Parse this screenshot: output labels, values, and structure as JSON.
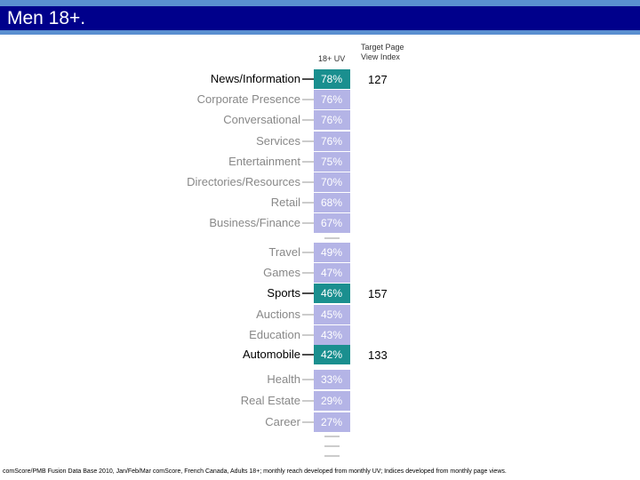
{
  "slide": {
    "title": "Men 18+.",
    "uv_header": "18+ UV",
    "index_header_line1": "Target Page",
    "index_header_line2": "View Index",
    "footnote": "comScore/PMB Fusion Data Base 2010, Jan/Feb/Mar comScore, French Canada, Adults 18+; monthly reach developed from monthly UV; Indices developed from monthly page views."
  },
  "colors": {
    "banner": "#00008b",
    "banner_rule": "#5a8fd0",
    "bar": "#b4b4e6",
    "bar_highlight": "#1a8f8f",
    "highlight_text": "#000000",
    "muted_text": "#888888"
  },
  "chart_data": {
    "type": "table",
    "columns": [
      "18+ UV",
      "Target Page View Index"
    ],
    "rows": [
      {
        "category": "News/Information",
        "uv": "78%",
        "index": "127",
        "highlight": true
      },
      {
        "category": "Corporate Presence",
        "uv": "76%",
        "index": "",
        "highlight": false
      },
      {
        "category": "Conversational",
        "uv": "76%",
        "index": "",
        "highlight": false
      },
      {
        "category": "Services",
        "uv": "76%",
        "index": "",
        "highlight": false
      },
      {
        "category": "Entertainment",
        "uv": "75%",
        "index": "",
        "highlight": false
      },
      {
        "category": "Directories/Resources",
        "uv": "70%",
        "index": "",
        "highlight": false
      },
      {
        "category": "Retail",
        "uv": "68%",
        "index": "",
        "highlight": false
      },
      {
        "category": "Business/Finance",
        "uv": "67%",
        "index": "",
        "highlight": false
      },
      {
        "category": "Travel",
        "uv": "49%",
        "index": "",
        "highlight": false
      },
      {
        "category": "Games",
        "uv": "47%",
        "index": "",
        "highlight": false
      },
      {
        "category": "Sports",
        "uv": "46%",
        "index": "157",
        "highlight": true
      },
      {
        "category": "Auctions",
        "uv": "45%",
        "index": "",
        "highlight": false
      },
      {
        "category": "Education",
        "uv": "43%",
        "index": "",
        "highlight": false
      },
      {
        "category": "Automobile",
        "uv": "42%",
        "index": "133",
        "highlight": true
      },
      {
        "category": "Health",
        "uv": "33%",
        "index": "",
        "highlight": false
      },
      {
        "category": "Real Estate",
        "uv": "29%",
        "index": "",
        "highlight": false
      },
      {
        "category": "Career",
        "uv": "27%",
        "index": "",
        "highlight": false
      }
    ]
  }
}
